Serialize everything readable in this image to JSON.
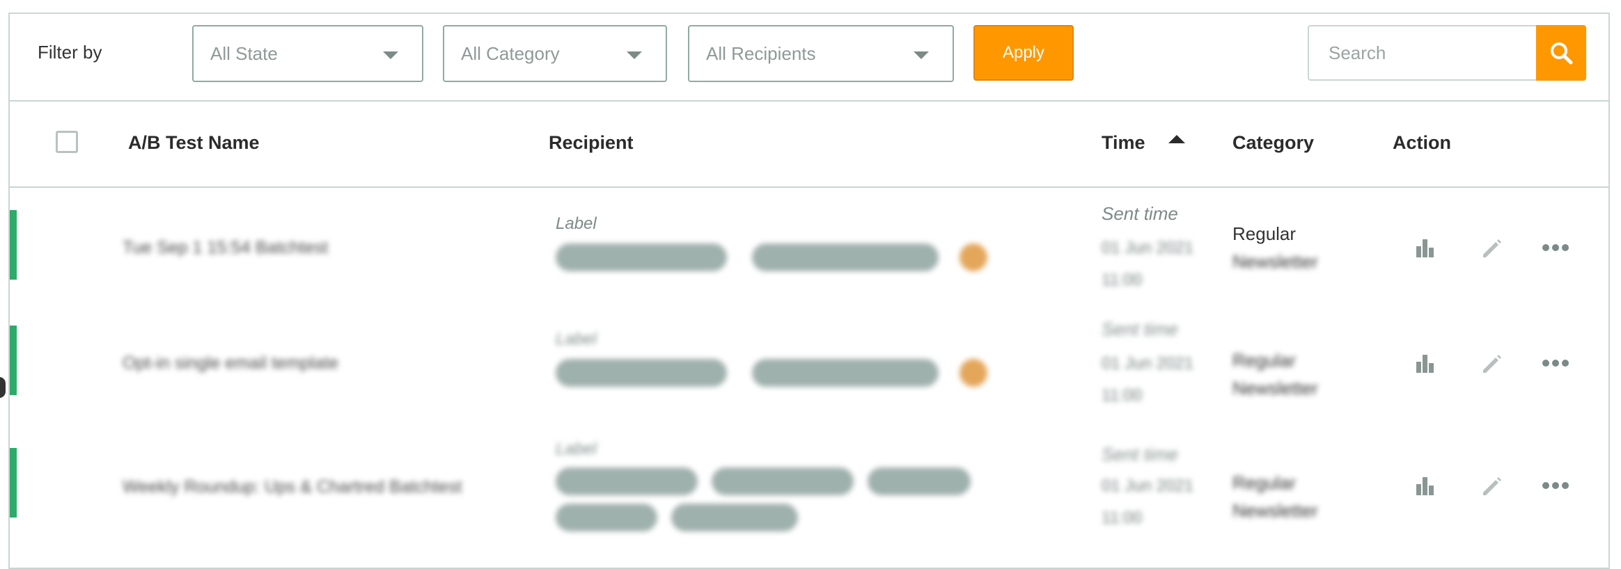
{
  "filter": {
    "label": "Filter by",
    "state": {
      "value": "All State"
    },
    "category": {
      "value": "All Category"
    },
    "recipients": {
      "value": "All Recipients"
    },
    "apply_label": "Apply",
    "search_placeholder": "Search"
  },
  "table": {
    "headers": {
      "name": "A/B Test Name",
      "recipient": "Recipient",
      "time": "Time",
      "category": "Category",
      "action": "Action"
    },
    "rows": [
      {
        "name": "Tue Sep 1 15:54 Batchtest",
        "label_caption": "Label",
        "time_caption": "Sent time",
        "time_lines": [
          "01 Jun 2021",
          "11:00"
        ],
        "category_lines": [
          "Regular",
          "Newsletter"
        ]
      },
      {
        "name": "Opt-in single email template",
        "label_caption": "Label",
        "time_caption": "Sent time",
        "time_lines": [
          "01 Jun 2021",
          "11:00"
        ],
        "category_lines": [
          "Regular",
          "Newsletter"
        ]
      },
      {
        "name": "Weekly Roundup: Ups & Chartred Batchtest",
        "label_caption": "Label",
        "time_caption": "Sent time",
        "time_lines": [
          "01 Jun 2021",
          "11:00"
        ],
        "category_lines": [
          "Regular",
          "Newsletter"
        ]
      }
    ]
  },
  "colors": {
    "accent": "#ff9800",
    "row_status": "#2eaa6a",
    "border": "#c9d6d2"
  },
  "icons": [
    "chevron-down-icon",
    "search-icon",
    "sort-ascending-icon",
    "bar-chart-icon",
    "pencil-icon",
    "more-horizontal-icon"
  ]
}
